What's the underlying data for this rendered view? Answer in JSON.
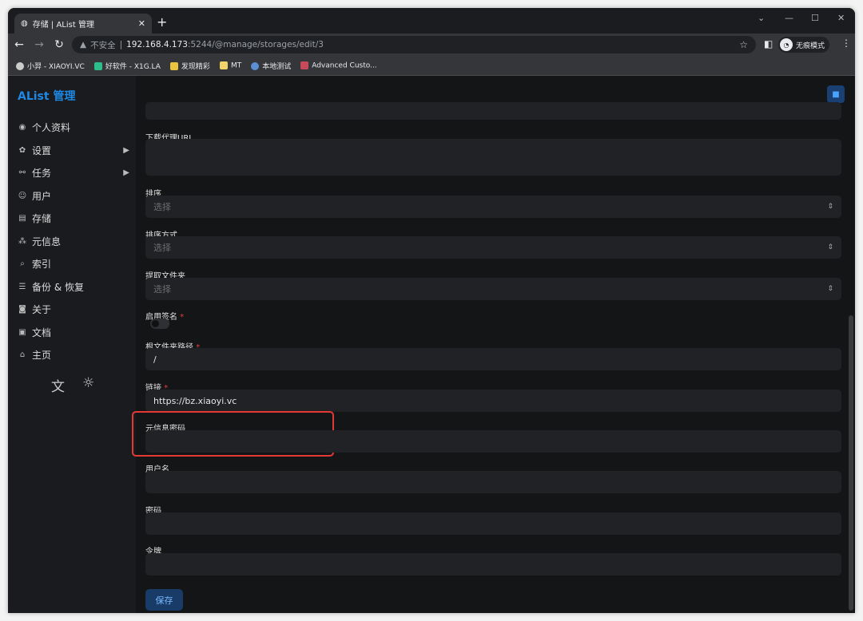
{
  "browser": {
    "tab_title": "存储 | AList 管理",
    "url_warning": "不安全",
    "url_host": "192.168.4.173",
    "url_rest": ":5244/@manage/storages/edit/3",
    "profile_label": "无痕模式",
    "bookmarks": [
      "小羿 - XIAOYI.VC",
      "好软件 - X1G.LA",
      "发现精彩",
      "MT",
      "本地测试",
      "Advanced Custo..."
    ]
  },
  "sidebar": {
    "brand": "AList 管理",
    "items": [
      {
        "label": "个人资料",
        "icon": "fingerprint-icon"
      },
      {
        "label": "设置",
        "icon": "gear-icon",
        "expandable": true
      },
      {
        "label": "任务",
        "icon": "workflow-icon",
        "expandable": true
      },
      {
        "label": "用户",
        "icon": "user-circle-icon"
      },
      {
        "label": "存储",
        "icon": "storage-icon"
      },
      {
        "label": "元信息",
        "icon": "meta-icon"
      },
      {
        "label": "索引",
        "icon": "search-icon"
      },
      {
        "label": "备份 & 恢复",
        "icon": "database-icon"
      },
      {
        "label": "关于",
        "icon": "info-icon"
      },
      {
        "label": "文档",
        "icon": "book-icon"
      },
      {
        "label": "主页",
        "icon": "home-icon"
      }
    ]
  },
  "form": {
    "fields": [
      {
        "label": "下载代理URL",
        "value": ""
      },
      {
        "label": "排序",
        "placeholder": "选择"
      },
      {
        "label": "排序方式",
        "placeholder": "选择"
      },
      {
        "label": "提取文件夹",
        "placeholder": "选择"
      },
      {
        "label": "启用签名",
        "required": true,
        "toggle": false
      },
      {
        "label": "根文件夹路径",
        "required": true,
        "value": "/"
      },
      {
        "label": "链接",
        "required": true,
        "value": "https://bz.xiaoyi.vc"
      },
      {
        "label": "元信息密码",
        "value": ""
      },
      {
        "label": "用户名",
        "value": ""
      },
      {
        "label": "密码",
        "value": ""
      },
      {
        "label": "令牌",
        "value": ""
      }
    ],
    "save_label": "保存",
    "required_mark": "*"
  },
  "colors": {
    "accent": "#1e88e5",
    "highlight": "#e53935"
  }
}
